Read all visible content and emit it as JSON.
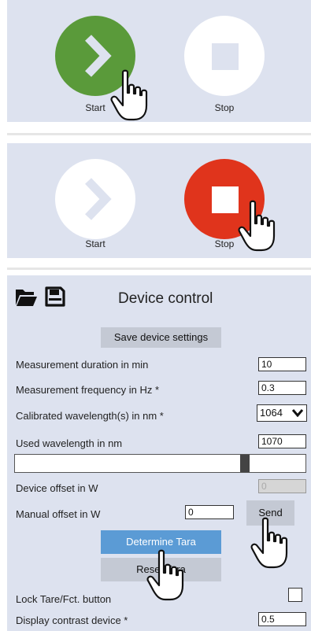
{
  "colors": {
    "panel_bg": "#dde2ef",
    "start_active": "#5a9a3a",
    "stop_active": "#e0341c",
    "button_inactive": "#ffffff",
    "determine_tara": "#5b9bd5",
    "gray_button": "#c4c9d4"
  },
  "panel1": {
    "start_label": "Start",
    "stop_label": "Stop",
    "active": "start"
  },
  "panel2": {
    "start_label": "Start",
    "stop_label": "Stop",
    "active": "stop"
  },
  "device": {
    "toolbar": {
      "open_icon": "folder-open-icon",
      "save_icon": "floppy-disk-icon"
    },
    "title": "Device control",
    "save_settings_label": "Save device settings",
    "measurement_duration": {
      "label": "Measurement duration in min",
      "value": "10"
    },
    "measurement_frequency": {
      "label": "Measurement frequency in Hz *",
      "value": "0.3"
    },
    "calibrated_wavelength": {
      "label": "Calibrated wavelength(s) in nm *",
      "value": "1064"
    },
    "used_wavelength": {
      "label": "Used wavelength in nm",
      "value": "1070"
    },
    "wavelength_slider": {
      "fraction": 0.8
    },
    "device_offset": {
      "label": "Device offset in W",
      "value": "0"
    },
    "manual_offset": {
      "label": "Manual offset in W",
      "value": "0",
      "send_label": "Send"
    },
    "determine_tara_label": "Determine Tara",
    "reset_tara_label": "Reset Tara",
    "lock_tare": {
      "label": "Lock Tare/Fct. button",
      "checked": false
    },
    "display_contrast": {
      "label": "Display contrast device *",
      "value": "0.5"
    }
  }
}
